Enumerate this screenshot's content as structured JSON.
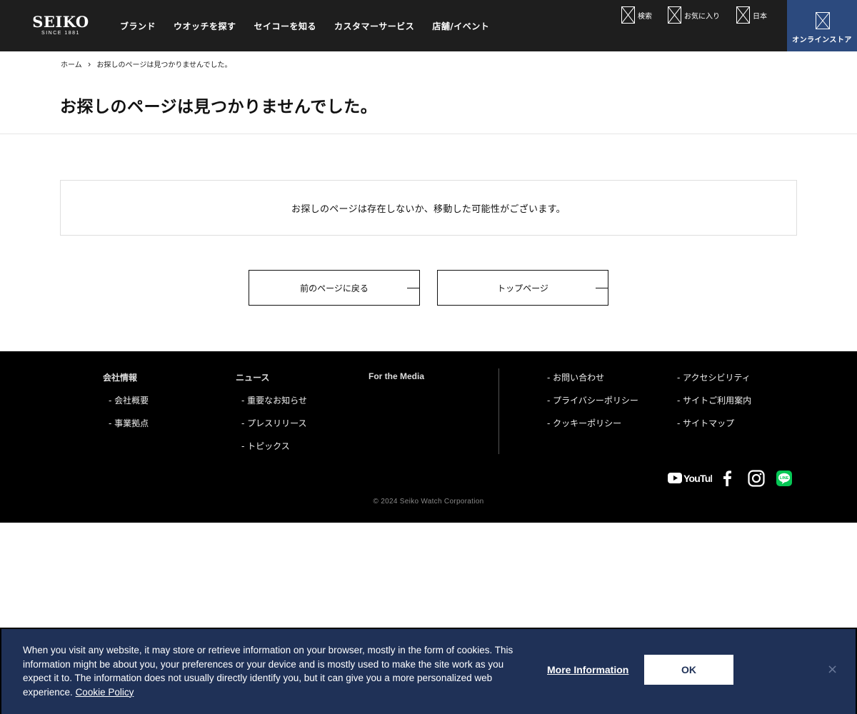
{
  "header": {
    "logo_main": "SEIKO",
    "logo_sub": "SINCE 1881",
    "nav": [
      "ブランド",
      "ウオッチを探す",
      "セイコーを知る",
      "カスタマーサービス",
      "店舗/イベント"
    ],
    "utility": {
      "search_label": "検索",
      "favorites_label": "お気に入り",
      "region_label": "日本"
    },
    "online_store_label": "オンラインストア"
  },
  "breadcrumb": {
    "home": "ホーム",
    "current": "お探しのページは見つかりませんでした。"
  },
  "page_title": "お探しのページは見つかりませんでした。",
  "message": "お探しのページは存在しないか、移動した可能性がございます。",
  "buttons": {
    "back": "前のページに戻る",
    "top": "トップページ"
  },
  "footer": {
    "company": {
      "heading": "会社情報",
      "links": [
        "会社概要",
        "事業拠点"
      ]
    },
    "news": {
      "heading": "ニュース",
      "links": [
        "重要なお知らせ",
        "プレスリリース",
        "トピックス"
      ]
    },
    "media_heading": "For the Media",
    "right_col1": [
      "お問い合わせ",
      "プライバシーポリシー",
      "クッキーポリシー"
    ],
    "right_col2": [
      "アクセシビリティ",
      "サイトご利用案内",
      "サイトマップ"
    ],
    "youtube_label": "YouTube",
    "line_label": "LINE",
    "copyright": "© 2024 Seiko Watch Corporation"
  },
  "cookie": {
    "text": "When you visit any website, it may store or retrieve information on your browser, mostly in the form of cookies. This information might be about you, your preferences or your device and is mostly used to make the site work as you expect it to. The information does not usually directly identify you, but it can give you a more personalized web experience.",
    "policy_link": "Cookie Policy",
    "more_info": "More Information",
    "ok": "OK",
    "close": "×"
  },
  "colors": {
    "header_bg": "#1e1e1e",
    "online_store_bg": "#2c4a7e",
    "footer_bg": "#000000",
    "cookie_bg": "#1f3157",
    "line_green": "#06c755"
  }
}
